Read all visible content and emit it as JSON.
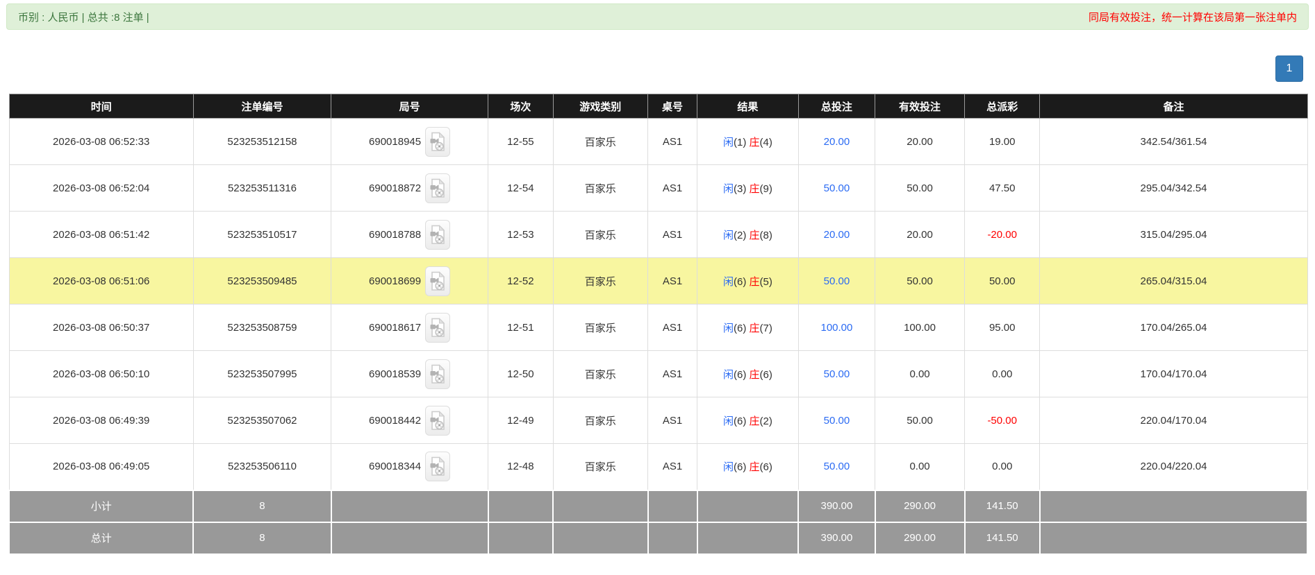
{
  "meta_bar": {
    "left_text": "币别 : 人民币 | 总共 :8 注单 |",
    "right_text": "同局有效投注，统一计算在该局第一张注单内"
  },
  "pagination": {
    "current_page": "1"
  },
  "colors": {
    "bar_bg": "#dff0d8",
    "bar_text_green": "#3c763d",
    "warning_red": "#ff0000",
    "header_bg": "#1b1b1b",
    "summary_bg": "#999999",
    "highlight_yellow": "#f8f6a0",
    "link_blue": "#2b6bf3",
    "pager_blue": "#337ab7"
  },
  "table": {
    "columns": [
      "时间",
      "注单编号",
      "局号",
      "场次",
      "游戏类别",
      "桌号",
      "结果",
      "总投注",
      "有效投注",
      "总派彩",
      "备注"
    ],
    "video_icon_name": "video-record-icon",
    "rows": [
      {
        "time": "2026-03-08 06:52:33",
        "bet_id": "523253512158",
        "round_id": "690018945",
        "session": "12-55",
        "game_type": "百家乐",
        "table_no": "AS1",
        "result": {
          "player_label": "闲",
          "player_count": "(1)",
          "banker_label": "庄",
          "banker_count": "(4)"
        },
        "bet_total": "20.00",
        "valid_bet": "20.00",
        "payout": "19.00",
        "payout_negative": false,
        "remark": "342.54/361.54",
        "highlighted": false
      },
      {
        "time": "2026-03-08 06:52:04",
        "bet_id": "523253511316",
        "round_id": "690018872",
        "session": "12-54",
        "game_type": "百家乐",
        "table_no": "AS1",
        "result": {
          "player_label": "闲",
          "player_count": "(3)",
          "banker_label": "庄",
          "banker_count": "(9)"
        },
        "bet_total": "50.00",
        "valid_bet": "50.00",
        "payout": "47.50",
        "payout_negative": false,
        "remark": "295.04/342.54",
        "highlighted": false
      },
      {
        "time": "2026-03-08 06:51:42",
        "bet_id": "523253510517",
        "round_id": "690018788",
        "session": "12-53",
        "game_type": "百家乐",
        "table_no": "AS1",
        "result": {
          "player_label": "闲",
          "player_count": "(2)",
          "banker_label": "庄",
          "banker_count": "(8)"
        },
        "bet_total": "20.00",
        "valid_bet": "20.00",
        "payout": "-20.00",
        "payout_negative": true,
        "remark": "315.04/295.04",
        "highlighted": false
      },
      {
        "time": "2026-03-08 06:51:06",
        "bet_id": "523253509485",
        "round_id": "690018699",
        "session": "12-52",
        "game_type": "百家乐",
        "table_no": "AS1",
        "result": {
          "player_label": "闲",
          "player_count": "(6)",
          "banker_label": "庄",
          "banker_count": "(5)"
        },
        "bet_total": "50.00",
        "valid_bet": "50.00",
        "payout": "50.00",
        "payout_negative": false,
        "remark": "265.04/315.04",
        "highlighted": true
      },
      {
        "time": "2026-03-08 06:50:37",
        "bet_id": "523253508759",
        "round_id": "690018617",
        "session": "12-51",
        "game_type": "百家乐",
        "table_no": "AS1",
        "result": {
          "player_label": "闲",
          "player_count": "(6)",
          "banker_label": "庄",
          "banker_count": "(7)"
        },
        "bet_total": "100.00",
        "valid_bet": "100.00",
        "payout": "95.00",
        "payout_negative": false,
        "remark": "170.04/265.04",
        "highlighted": false
      },
      {
        "time": "2026-03-08 06:50:10",
        "bet_id": "523253507995",
        "round_id": "690018539",
        "session": "12-50",
        "game_type": "百家乐",
        "table_no": "AS1",
        "result": {
          "player_label": "闲",
          "player_count": "(6)",
          "banker_label": "庄",
          "banker_count": "(6)"
        },
        "bet_total": "50.00",
        "valid_bet": "0.00",
        "payout": "0.00",
        "payout_negative": false,
        "remark": "170.04/170.04",
        "highlighted": false
      },
      {
        "time": "2026-03-08 06:49:39",
        "bet_id": "523253507062",
        "round_id": "690018442",
        "session": "12-49",
        "game_type": "百家乐",
        "table_no": "AS1",
        "result": {
          "player_label": "闲",
          "player_count": "(6)",
          "banker_label": "庄",
          "banker_count": "(2)"
        },
        "bet_total": "50.00",
        "valid_bet": "50.00",
        "payout": "-50.00",
        "payout_negative": true,
        "remark": "220.04/170.04",
        "highlighted": false
      },
      {
        "time": "2026-03-08 06:49:05",
        "bet_id": "523253506110",
        "round_id": "690018344",
        "session": "12-48",
        "game_type": "百家乐",
        "table_no": "AS1",
        "result": {
          "player_label": "闲",
          "player_count": "(6)",
          "banker_label": "庄",
          "banker_count": "(6)"
        },
        "bet_total": "50.00",
        "valid_bet": "0.00",
        "payout": "0.00",
        "payout_negative": false,
        "remark": "220.04/220.04",
        "highlighted": false
      }
    ],
    "summary_rows": [
      {
        "label": "小计",
        "count": "8",
        "bet_total": "390.00",
        "valid_bet": "290.00",
        "payout": "141.50",
        "remark": ""
      },
      {
        "label": "总计",
        "count": "8",
        "bet_total": "390.00",
        "valid_bet": "290.00",
        "payout": "141.50",
        "remark": ""
      }
    ]
  }
}
